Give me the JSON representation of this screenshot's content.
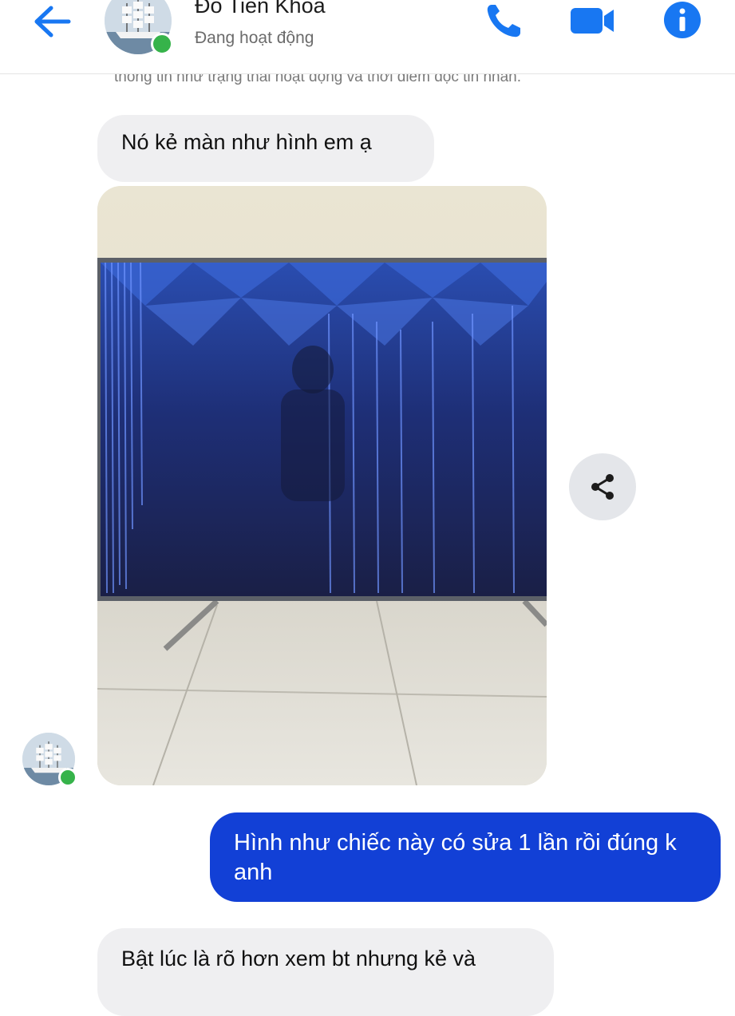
{
  "header": {
    "contact_name": "Đỗ Tiến Khoa",
    "status": "Đang hoạt động",
    "accent_color": "#1877f2",
    "online_color": "#36b34a",
    "icons": [
      "back-arrow-icon",
      "phone-icon",
      "video-camera-icon",
      "info-icon"
    ]
  },
  "notice": "thông tin như trạng thái hoạt động và thời điểm đọc tin nhắn.",
  "messages": [
    {
      "from": "contact",
      "text": "Nó kẻ màn như hình em ạ"
    },
    {
      "from": "contact",
      "type": "image",
      "content": "tv-photo-with-vertical-lines"
    },
    {
      "from": "me",
      "text": "Hình như chiếc này có sửa 1 lần rồi đúng k anh"
    },
    {
      "from": "contact",
      "text": "Bật lúc là rõ hơn xem bt nhưng kẻ và"
    }
  ],
  "colors": {
    "outgoing_bubble": "#1240d6",
    "incoming_bubble": "#efeff1"
  }
}
